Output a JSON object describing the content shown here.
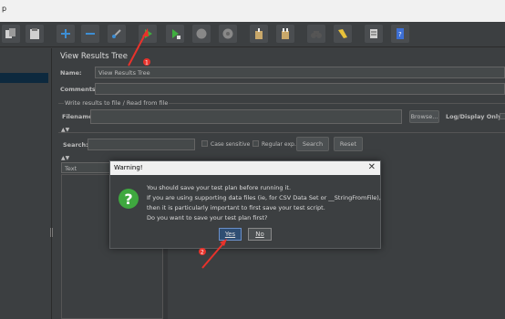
{
  "menubar": {
    "text": "p"
  },
  "toolbar": {
    "buttons": [
      {
        "name": "copy-icon",
        "color": "#d0d0d0"
      },
      {
        "name": "paste-icon",
        "color": "#d0d0d0"
      },
      {
        "name": "expand-icon",
        "color": "#3d8ed4"
      },
      {
        "name": "collapse-icon",
        "color": "#3d8ed4"
      },
      {
        "name": "toggle-icon",
        "color": "#aaaaaa"
      },
      {
        "name": "start-icon",
        "color": "#3fae3f"
      },
      {
        "name": "start-no-pause-icon",
        "color": "#3fae3f"
      },
      {
        "name": "stop-icon",
        "color": "#888888"
      },
      {
        "name": "shutdown-icon",
        "color": "#888888"
      },
      {
        "name": "clear-icon",
        "color": "#c9a86a"
      },
      {
        "name": "clear-all-icon",
        "color": "#c9a86a"
      },
      {
        "name": "search-binoculars-icon",
        "color": "#666666"
      },
      {
        "name": "reset-search-icon",
        "color": "#e8c23a"
      },
      {
        "name": "function-helper-icon",
        "color": "#d0d0d0"
      },
      {
        "name": "help-icon",
        "color": "#3d6fd4"
      }
    ]
  },
  "panel": {
    "title": "View Results Tree",
    "name_label": "Name:",
    "name_value": "View Results Tree",
    "comments_label": "Comments:",
    "write_results_label": "Write results to file / Read from file",
    "filename_label": "Filename",
    "browse_label": "Browse...",
    "log_display_label": "Log/Display Only:",
    "search_label": "Search:",
    "case_sensitive_label": "Case sensitive",
    "regular_exp_label": "Regular exp.",
    "search_button": "Search",
    "reset_button": "Reset",
    "renderer_value": "Text"
  },
  "dialog": {
    "title": "Warning!",
    "close_symbol": "✕",
    "icon_symbol": "?",
    "lines": [
      "You should save your test plan before running it.",
      "If you are using supporting data files (ie, for CSV Data Set or __StringFromFile),",
      "then it is particularly important to first save your test script.",
      "Do you want to save your test plan first?"
    ],
    "yes_label": "Yes",
    "no_label": "No"
  },
  "annotations": {
    "badge1": "1",
    "badge2": "2"
  }
}
